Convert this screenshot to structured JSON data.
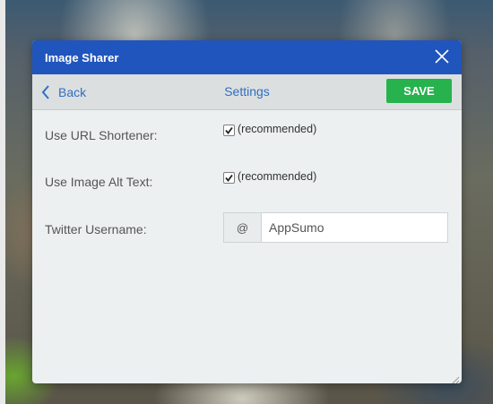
{
  "dialog": {
    "title": "Image Sharer"
  },
  "toolbar": {
    "back_label": "Back",
    "heading": "Settings",
    "save_label": "SAVE"
  },
  "settings": {
    "url_shortener": {
      "label": "Use URL Shortener:",
      "checked": true,
      "note": "(recommended)"
    },
    "image_alt_text": {
      "label": "Use Image Alt Text:",
      "checked": true,
      "note": "(recommended)"
    },
    "twitter_username": {
      "label": "Twitter Username:",
      "prefix": "@",
      "value": "AppSumo"
    }
  },
  "colors": {
    "titlebar": "#2055bd",
    "save_button": "#27b24e",
    "link": "#2f6fc2"
  },
  "icons": {
    "close": "close-icon",
    "back": "chevron-left-icon",
    "check": "checkmark-icon",
    "resize": "resize-grip-icon"
  }
}
